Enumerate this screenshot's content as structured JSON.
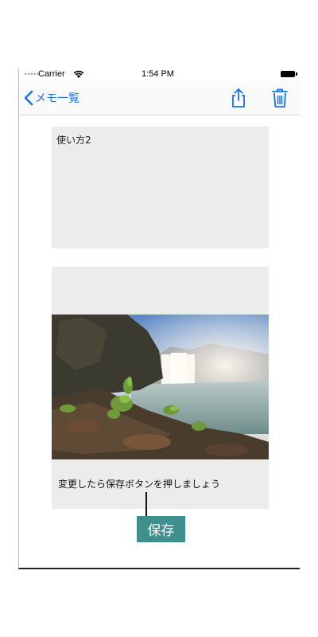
{
  "status_bar": {
    "carrier": "Carrier",
    "time": "1:54 PM"
  },
  "navbar": {
    "back_label": "メモ一覧"
  },
  "memo": {
    "title": "使い方2",
    "caption": "変更したら保存ボタンを押しましょう"
  },
  "save_button": {
    "label": "保存"
  },
  "colors": {
    "accent": "#1a73e8",
    "save_button": "#3f8f8e",
    "card_background": "#ececec"
  },
  "icons": [
    "wifi-icon",
    "battery-icon",
    "chevron-left-icon",
    "share-icon",
    "trash-icon"
  ]
}
